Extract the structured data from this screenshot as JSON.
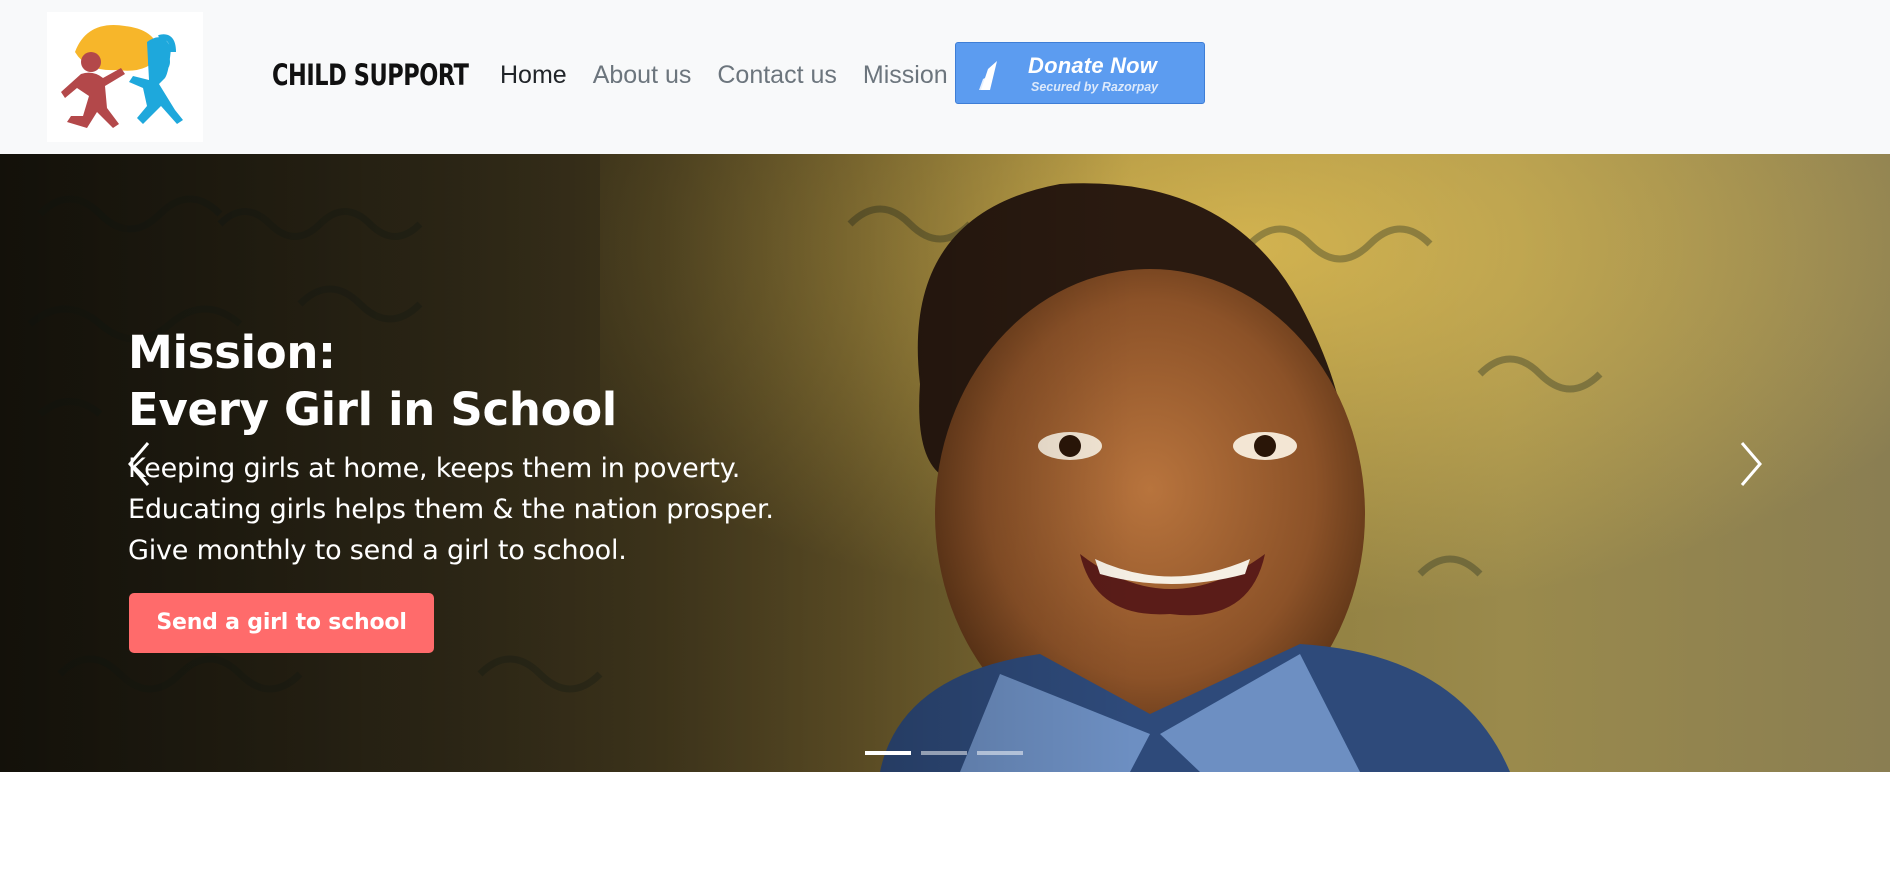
{
  "brand": {
    "logo_icon": "children-running-logo-icon",
    "name": "CHILD SUPPORT"
  },
  "nav": {
    "items": [
      {
        "label": "Home",
        "active": true
      },
      {
        "label": "About us",
        "active": false
      },
      {
        "label": "Contact us",
        "active": false
      },
      {
        "label": "Mission",
        "active": false
      }
    ]
  },
  "donate": {
    "label": "Donate Now",
    "sublabel": "Secured by Razorpay",
    "icon": "razorpay-icon",
    "color": "#5c9cf0"
  },
  "hero": {
    "title_line1": "Mission:",
    "title_line2": "Every Girl in School",
    "body_line1": "Keeping girls at home, keeps them in poverty.",
    "body_line2": "Educating girls helps them & the nation prosper.",
    "body_line3": "Give monthly to send a girl to school.",
    "cta_label": "Send a girl to school",
    "cta_color": "#ff6b6b",
    "prev_icon": "chevron-left-icon",
    "next_icon": "chevron-right-icon",
    "slides_total": 3,
    "active_slide": 1
  }
}
